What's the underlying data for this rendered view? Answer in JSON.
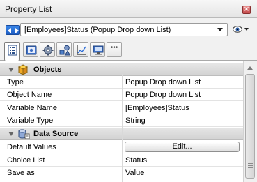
{
  "window": {
    "title": "Property List",
    "close_glyph": "×"
  },
  "selector": {
    "value": "[Employees]Status (Popup Drop down List)",
    "nav_icon": "nav-arrows-icon",
    "eye_icon": "eye-icon"
  },
  "tabs": [
    {
      "name": "tab-list",
      "icon": "list-icon",
      "active": true
    },
    {
      "name": "tab-form",
      "icon": "form-icon",
      "active": false
    },
    {
      "name": "tab-gear",
      "icon": "gear-icon",
      "active": false
    },
    {
      "name": "tab-shapes",
      "icon": "shapes-icon",
      "active": false
    },
    {
      "name": "tab-graph",
      "icon": "graph-icon",
      "active": false
    },
    {
      "name": "tab-monitor",
      "icon": "monitor-icon",
      "active": false
    },
    {
      "name": "tab-more",
      "icon": "more-icon",
      "label": "•••",
      "active": false
    }
  ],
  "sections": {
    "objects": {
      "label": "Objects",
      "icon": "cube-icon",
      "rows": [
        {
          "name": "Type",
          "value": "Popup Drop down List"
        },
        {
          "name": "Object Name",
          "value": "Popup Drop down List"
        },
        {
          "name": "Variable Name",
          "value": "[Employees]Status"
        },
        {
          "name": "Variable Type",
          "value": "String"
        }
      ]
    },
    "data_source": {
      "label": "Data Source",
      "icon": "database-icon",
      "rows": [
        {
          "name": "Default Values",
          "button": "Edit..."
        },
        {
          "name": "Choice List",
          "value": "Status"
        },
        {
          "name": "Save as",
          "value": "Value"
        }
      ]
    }
  },
  "colors": {
    "accent": "#2f6fd8",
    "section_bg": "#dcdcdc",
    "close_red": "#c24848"
  }
}
